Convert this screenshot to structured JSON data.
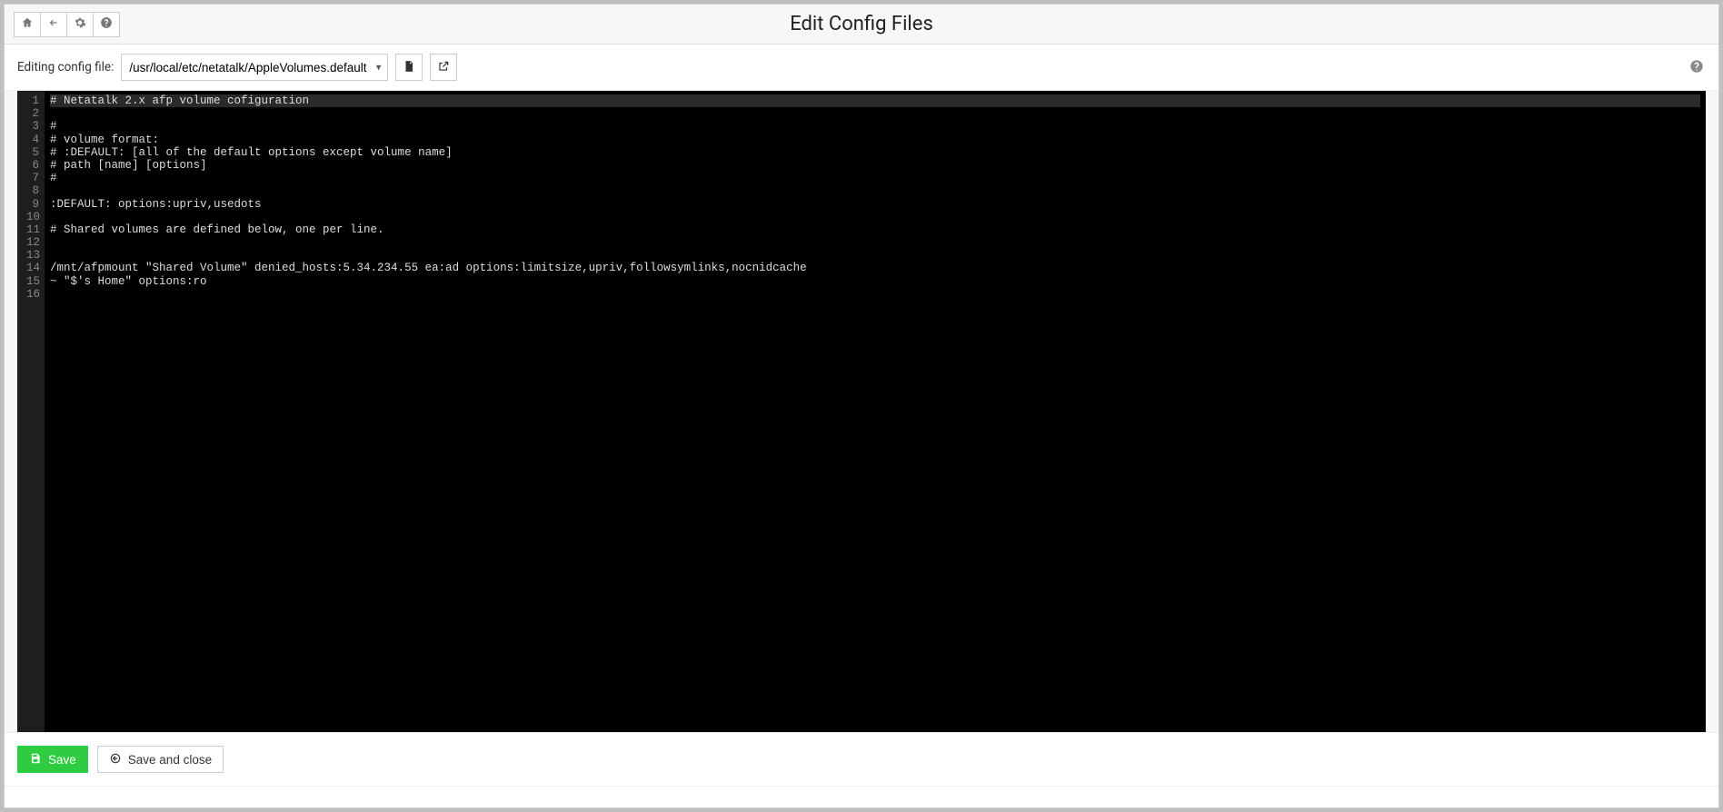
{
  "header": {
    "page_title": "Edit Config Files"
  },
  "toolbar": {
    "label": "Editing config file:",
    "selected_file": "/usr/local/etc/netatalk/AppleVolumes.default"
  },
  "editor": {
    "active_line": 1,
    "lines": [
      "# Netatalk 2.x afp volume cofiguration",
      "",
      "#",
      "# volume format:",
      "# :DEFAULT: [all of the default options except volume name]",
      "# path [name] [options]",
      "#",
      "",
      ":DEFAULT: options:upriv,usedots",
      "",
      "# Shared volumes are defined below, one per line.",
      "",
      "",
      "/mnt/afpmount \"Shared Volume\" denied_hosts:5.34.234.55 ea:ad options:limitsize,upriv,followsymlinks,nocnidcache",
      "~ \"$'s Home\" options:ro",
      ""
    ]
  },
  "footer": {
    "save_label": "Save",
    "save_close_label": "Save and close"
  }
}
